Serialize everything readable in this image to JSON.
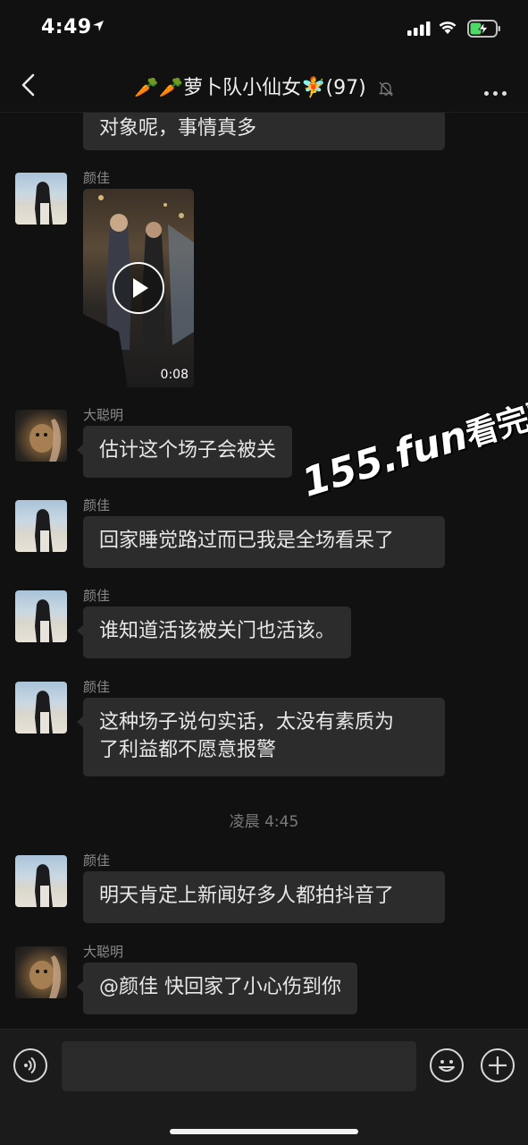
{
  "status_bar": {
    "time": "4:49",
    "icons": [
      "location-arrow-icon",
      "cellular-signal-icon",
      "wifi-icon",
      "battery-charging-icon"
    ]
  },
  "nav": {
    "title": "🥕🥕萝卜队小仙女🧚(97)",
    "icons": [
      "back-chevron-icon",
      "mute-bell-icon",
      "more-dots-icon"
    ]
  },
  "messages": [
    {
      "sender": "",
      "text": "对象呢，事情真多",
      "type": "text"
    },
    {
      "sender": "颜佳",
      "type": "video",
      "duration": "0:08"
    },
    {
      "sender": "大聪明",
      "text": "估计这个场子会被关",
      "type": "text"
    },
    {
      "sender": "颜佳",
      "text": "回家睡觉路过而已我是全场看呆了",
      "type": "text"
    },
    {
      "sender": "颜佳",
      "text": "谁知道活该被关门也活该。",
      "type": "text"
    },
    {
      "sender": "颜佳",
      "text_line1": "这种场子说句实话，太没有素质为",
      "text_line2": "了利益都不愿意报警",
      "type": "text"
    },
    {
      "sender": "颜佳",
      "text": "明天肯定上新闻好多人都拍抖音了",
      "type": "text"
    },
    {
      "sender": "大聪明",
      "text": "@颜佳 快回家了小心伤到你",
      "type": "text"
    }
  ],
  "timestamp": "凌晨 4:45",
  "watermark": {
    "part1": "155.fun",
    "part2": "看完整版"
  },
  "input_bar": {
    "icons": [
      "voice-icon",
      "emoji-icon",
      "plus-icon"
    ],
    "placeholder": ""
  }
}
